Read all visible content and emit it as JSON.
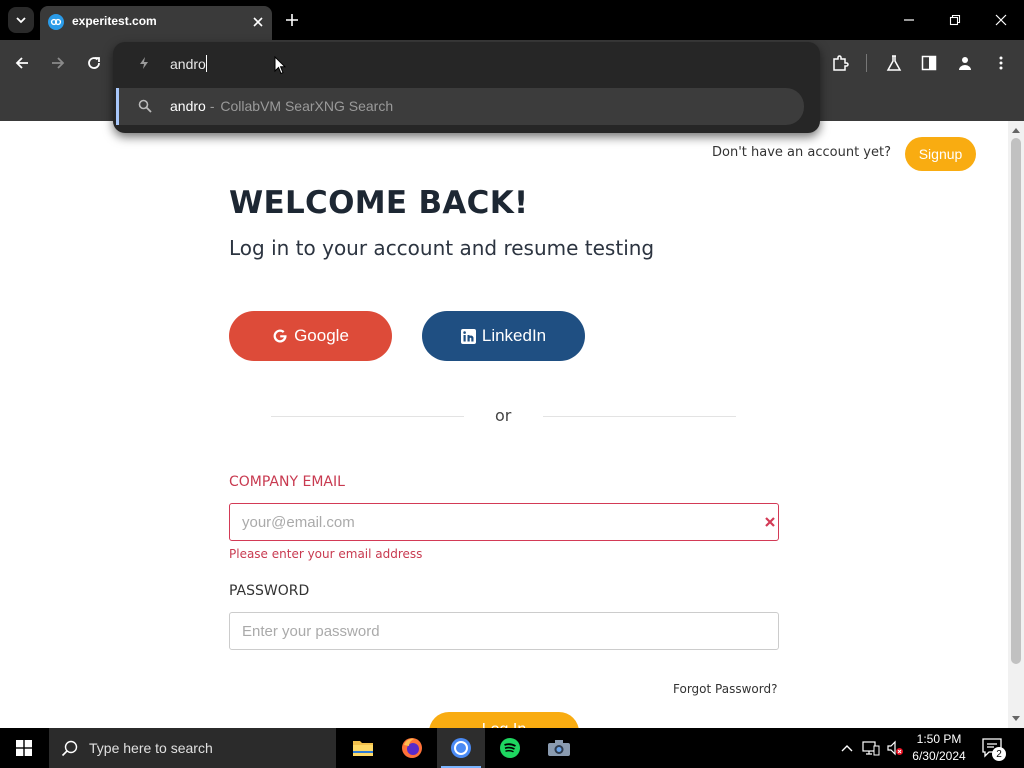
{
  "browser": {
    "tab": {
      "title": "experitest.com"
    },
    "omnibox": {
      "value": "andro",
      "suggestion": {
        "query": "andro",
        "separator": "-",
        "engine": "CollabVM SearXNG Search"
      }
    }
  },
  "page": {
    "signup_prompt": "Don't have an account yet?",
    "signup_label": "Signup",
    "heading": "WELCOME BACK!",
    "subheading": "Log in to your account and resume testing",
    "google_label": "Google",
    "linkedin_label": "LinkedIn",
    "divider_text": "or",
    "email": {
      "label": "COMPANY EMAIL",
      "value": "",
      "placeholder": "your@email.com",
      "error": "Please enter your email address"
    },
    "password": {
      "label": "PASSWORD",
      "value": "",
      "placeholder": "Enter your password"
    },
    "forgot_label": "Forgot Password?",
    "login_label": "Log In",
    "colors": {
      "accent": "#f9ac11",
      "google": "#dd4b39",
      "linkedin": "#1f4f82",
      "error": "#c83a50"
    }
  },
  "taskbar": {
    "search_placeholder": "Type here to search",
    "time": "1:50 PM",
    "date": "6/30/2024",
    "notification_count": "2",
    "apps": [
      "file-explorer-icon",
      "firefox-icon",
      "chrome-icon",
      "spotify-icon",
      "camera-icon"
    ]
  }
}
